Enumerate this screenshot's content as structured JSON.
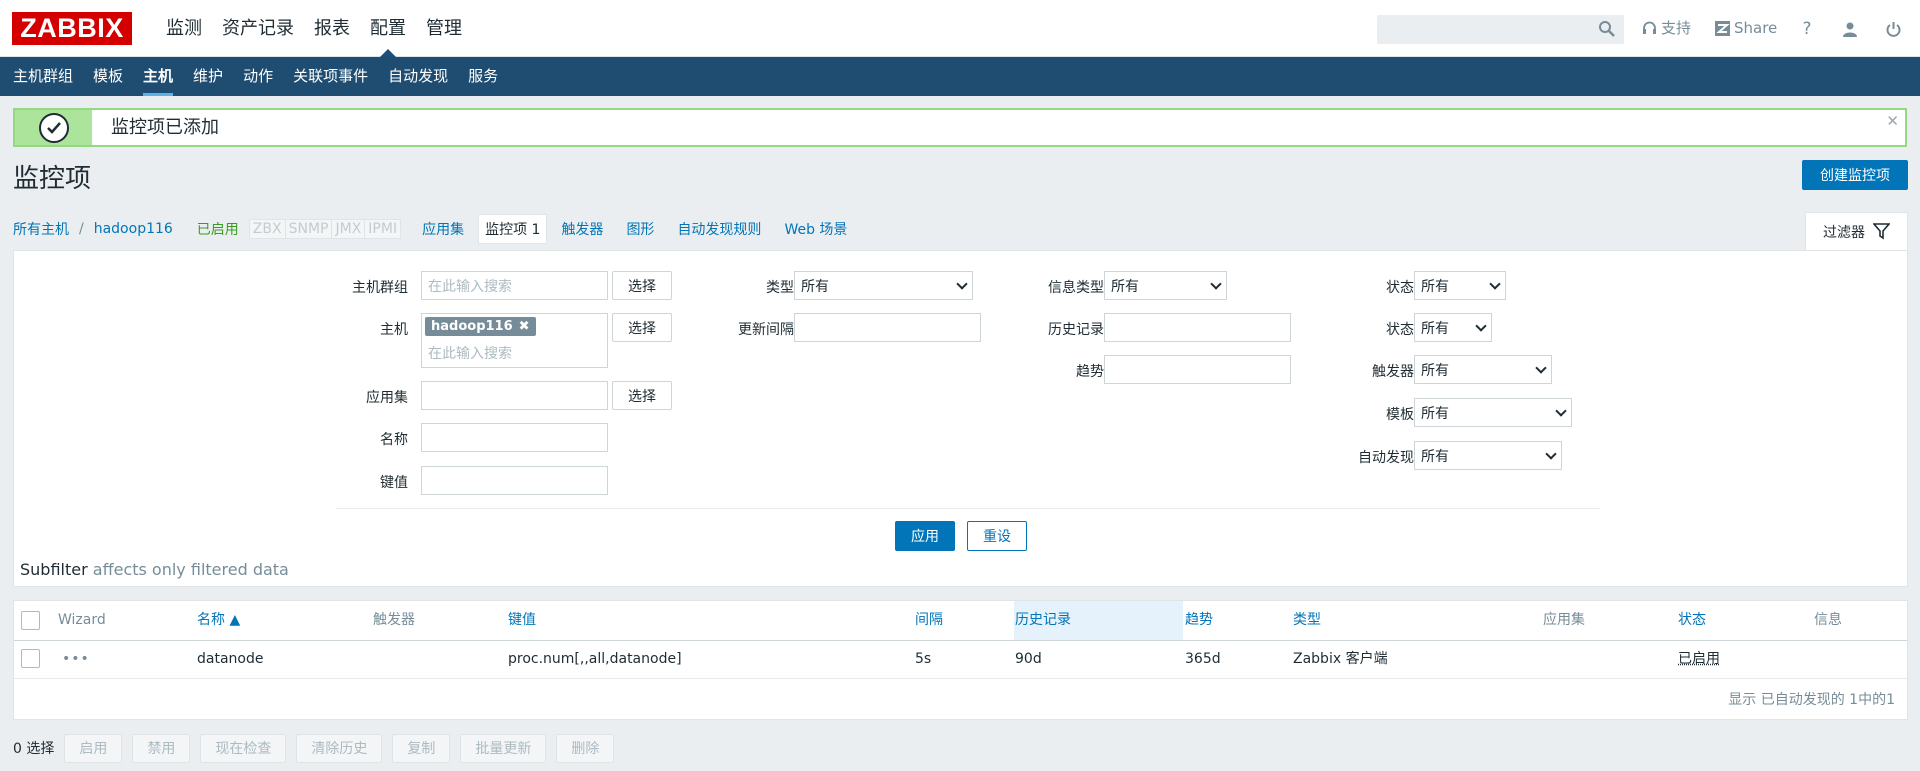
{
  "header": {
    "logo": "ZABBIX",
    "nav": [
      "监测",
      "资产记录",
      "报表",
      "配置",
      "管理"
    ],
    "support": "支持",
    "share": "Share",
    "help": "?"
  },
  "subnav": [
    "主机群组",
    "模板",
    "主机",
    "维护",
    "动作",
    "关联项事件",
    "自动发现",
    "服务"
  ],
  "message": {
    "text": "监控项已添加"
  },
  "page": {
    "title": "监控项",
    "create_button": "创建监控项"
  },
  "breadcrumb": {
    "all_hosts": "所有主机",
    "sep": "/",
    "host": "hadoop116",
    "status": "已启用",
    "protocols": [
      "ZBX",
      "SNMP",
      "JMX",
      "IPMI"
    ],
    "tabs": [
      "应用集",
      "监控项 1",
      "触发器",
      "图形",
      "自动发现规则",
      "Web 场景"
    ],
    "filter_tab": "过滤器"
  },
  "filter": {
    "host_group": {
      "label": "主机群组",
      "placeholder": "在此输入搜索",
      "button": "选择"
    },
    "host": {
      "label": "主机",
      "tag": "hadoop116",
      "placeholder": "在此输入搜索",
      "button": "选择"
    },
    "application": {
      "label": "应用集",
      "button": "选择"
    },
    "name": {
      "label": "名称"
    },
    "key": {
      "label": "键值"
    },
    "type": {
      "label": "类型",
      "value": "所有"
    },
    "interval": {
      "label": "更新间隔"
    },
    "info_type": {
      "label": "信息类型",
      "value": "所有"
    },
    "history": {
      "label": "历史记录"
    },
    "trends": {
      "label": "趋势"
    },
    "state": {
      "label": "状态",
      "value": "所有"
    },
    "status": {
      "label": "状态",
      "value": "所有"
    },
    "triggers": {
      "label": "触发器",
      "value": "所有"
    },
    "template": {
      "label": "模板",
      "value": "所有"
    },
    "discovery": {
      "label": "自动发现",
      "value": "所有"
    },
    "apply": "应用",
    "reset": "重设"
  },
  "subfilter": {
    "title": "Subfilter",
    "note": "affects only filtered data"
  },
  "table": {
    "headers": {
      "wizard": "Wizard",
      "name": "名称 ▲",
      "triggers": "触发器",
      "key": "键值",
      "interval": "间隔",
      "history": "历史记录",
      "trends": "趋势",
      "type": "类型",
      "applications": "应用集",
      "status": "状态",
      "info": "信息"
    },
    "rows": [
      {
        "wizard": "•••",
        "name": "datanode",
        "key": "proc.num[,,all,datanode]",
        "interval": "5s",
        "history": "90d",
        "trends": "365d",
        "type": "Zabbix 客户端",
        "status": "已启用"
      }
    ],
    "footer": "显示 已自动发现的 1中的1"
  },
  "bottom": {
    "selected": "0 选择",
    "buttons": [
      "启用",
      "禁用",
      "现在检查",
      "清除历史",
      "复制",
      "批量更新",
      "删除"
    ]
  }
}
